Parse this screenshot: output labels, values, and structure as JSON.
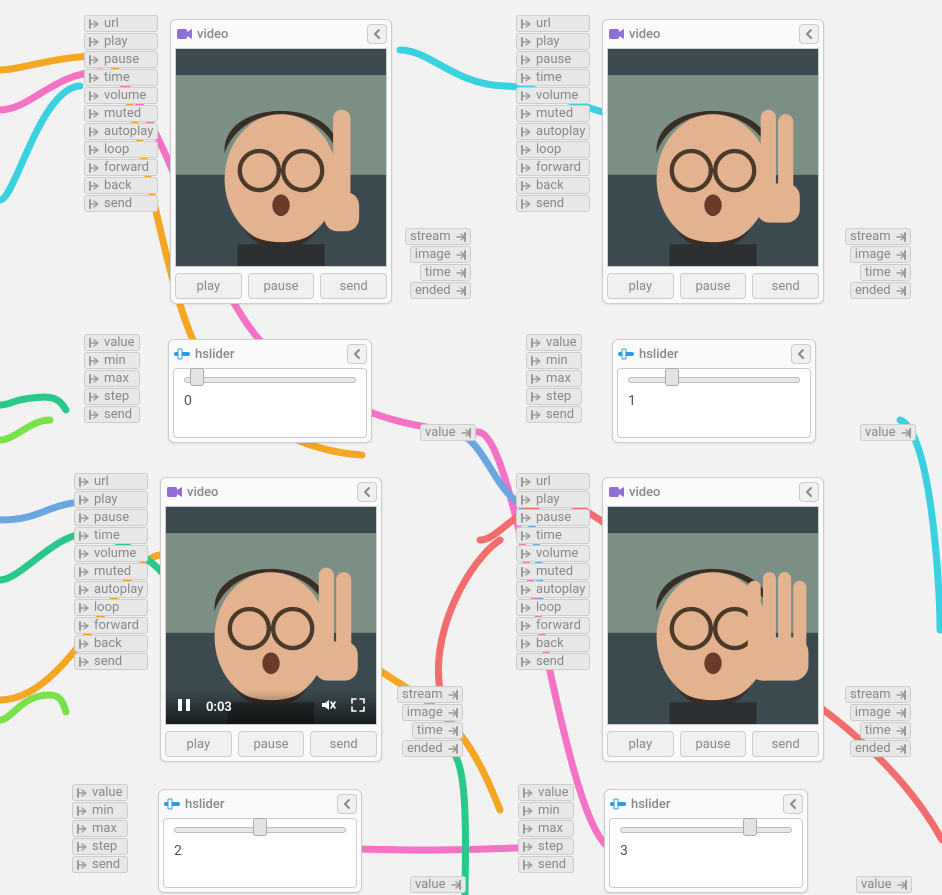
{
  "icons": {
    "video": "video-icon",
    "slider": "slider-icon",
    "chevron_left": "chevron-left-icon",
    "port_in": "port-in-icon",
    "port_out": "port-out-icon",
    "pause": "pause-icon",
    "volume_muted": "volume-muted-icon",
    "fullscreen": "fullscreen-icon"
  },
  "colors": {
    "video_icon": "#8f6ed6",
    "slider_icon": "#2c9be6",
    "wire_orange": "#f5a623",
    "wire_cyan": "#3ad1e0",
    "wire_blue": "#6aa7e0",
    "wire_pink": "#f573c6",
    "wire_red": "#f26d6d",
    "wire_green": "#29c98b",
    "wire_lime": "#79e24a"
  },
  "video_inputs": [
    "url",
    "play",
    "pause",
    "time",
    "volume",
    "muted",
    "autoplay",
    "loop",
    "forward",
    "back",
    "send"
  ],
  "video_outputs": [
    "stream",
    "image",
    "time",
    "ended"
  ],
  "slider_inputs": [
    "value",
    "min",
    "max",
    "step",
    "send"
  ],
  "slider_output": "value",
  "buttons": {
    "play": "play",
    "pause": "pause",
    "send": "send"
  },
  "nodes": {
    "video1": {
      "title": "video"
    },
    "video2": {
      "title": "video"
    },
    "video3": {
      "title": "video",
      "overlay_time": "0:03"
    },
    "video4": {
      "title": "video"
    },
    "slider1": {
      "title": "hslider",
      "value": 0,
      "display": "0",
      "range_pos": 3
    },
    "slider2": {
      "title": "hslider",
      "value": 1,
      "display": "1",
      "range_pos": 23
    },
    "slider3": {
      "title": "hslider",
      "value": 2,
      "display": "2",
      "range_pos": 50
    },
    "slider4": {
      "title": "hslider",
      "value": 3,
      "display": "3",
      "range_pos": 78
    }
  }
}
